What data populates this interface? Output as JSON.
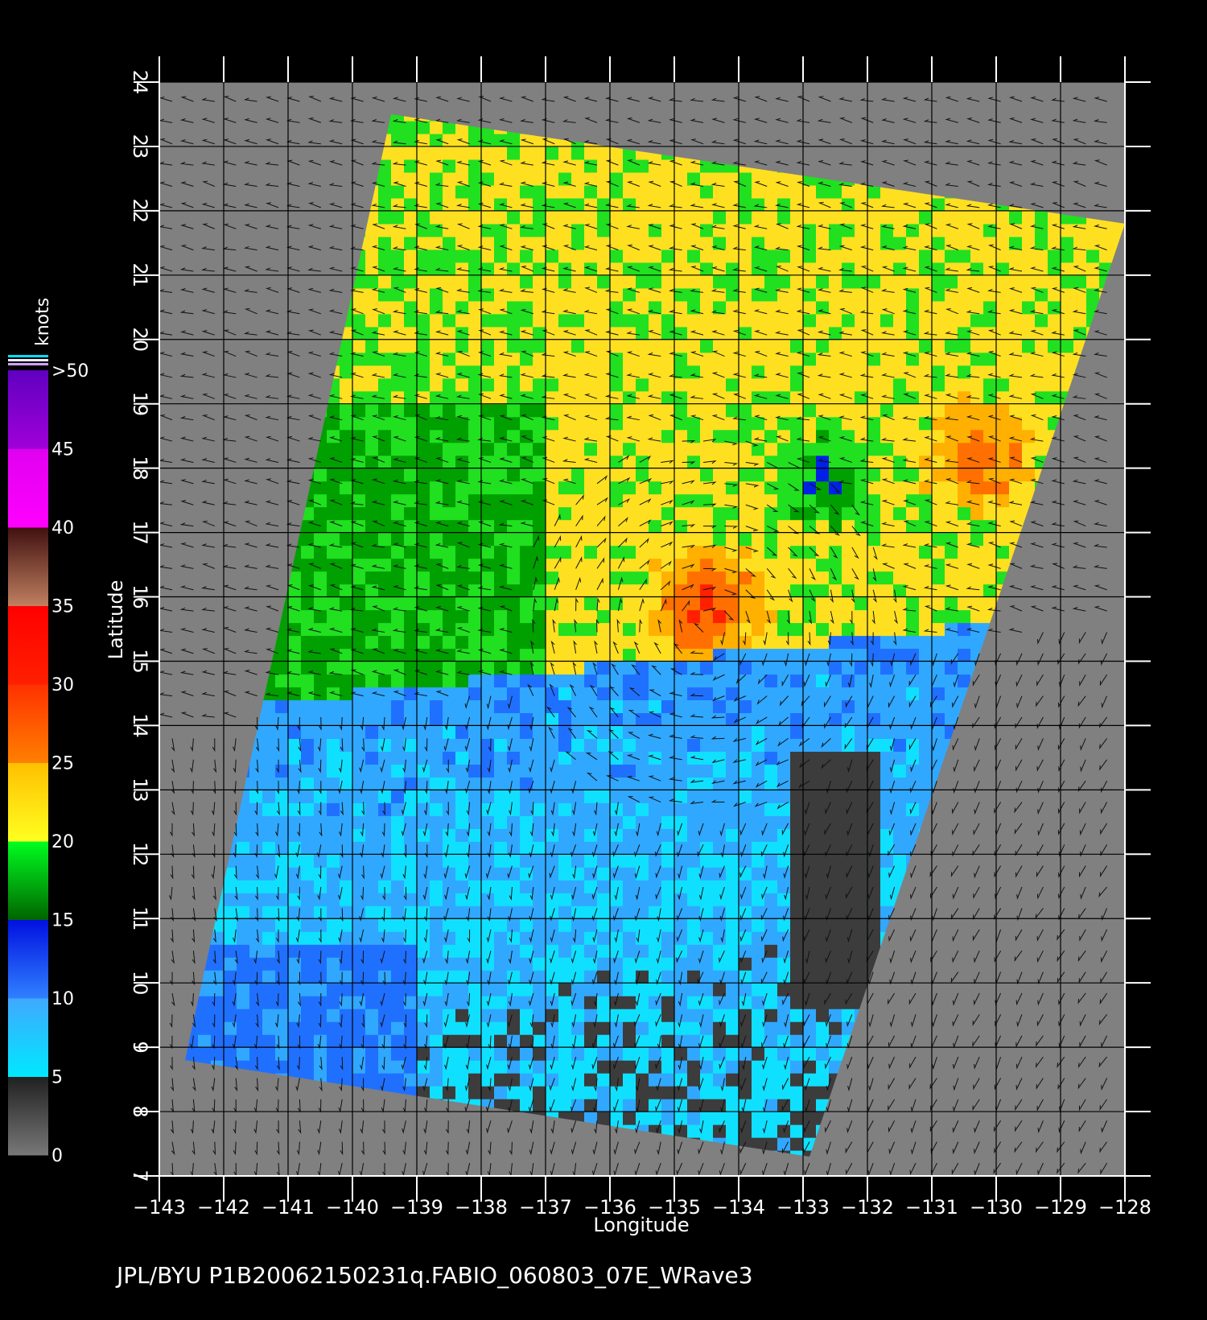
{
  "map": {
    "xlabel": "Longitude",
    "ylabel": "Latitude",
    "lon_range": [
      -143,
      -128
    ],
    "lat_range": [
      7,
      24
    ],
    "lon_ticks": [
      "−143",
      "−142",
      "−141",
      "−140",
      "−139",
      "−138",
      "−137",
      "−136",
      "−135",
      "−134",
      "−133",
      "−132",
      "−131",
      "−130",
      "−129",
      "−128"
    ],
    "lat_ticks": [
      "7",
      "8",
      "9",
      "10",
      "11",
      "12",
      "13",
      "14",
      "15",
      "16",
      "17",
      "18",
      "19",
      "20",
      "21",
      "22",
      "23",
      "24"
    ],
    "background": "#808080",
    "swath_corners_lonlat": [
      [
        -139.4,
        23.5
      ],
      [
        -128.0,
        21.8
      ],
      [
        -132.9,
        7.3
      ],
      [
        -142.6,
        8.8
      ]
    ],
    "storm_center_lonlat": [
      -134.5,
      15.5
    ]
  },
  "colorbar": {
    "units_label": "knots",
    "labels": [
      ">50",
      "45",
      "40",
      "35",
      "30",
      "25",
      "20",
      "15",
      "10",
      "5",
      "0"
    ],
    "bands": [
      {
        "from": 0,
        "to": 5,
        "colors": [
          "#787878",
          "#202020"
        ]
      },
      {
        "from": 5,
        "to": 10,
        "colors": [
          "#00e8ff",
          "#40a8ff"
        ]
      },
      {
        "from": 10,
        "to": 15,
        "colors": [
          "#3080ff",
          "#0010e0"
        ]
      },
      {
        "from": 15,
        "to": 20,
        "colors": [
          "#006400",
          "#00ff20"
        ]
      },
      {
        "from": 20,
        "to": 25,
        "colors": [
          "#ffff20",
          "#ffbf00"
        ]
      },
      {
        "from": 25,
        "to": 30,
        "colors": [
          "#ff8000",
          "#ff3000"
        ]
      },
      {
        "from": 30,
        "to": 35,
        "colors": [
          "#ff2000",
          "#ff0000"
        ]
      },
      {
        "from": 35,
        "to": 40,
        "colors": [
          "#c08060",
          "#401010"
        ]
      },
      {
        "from": 40,
        "to": 45,
        "colors": [
          "#ff00ff",
          "#e000f0"
        ]
      },
      {
        "from": 45,
        "to": 50,
        "colors": [
          "#a000d8",
          "#6000c0"
        ]
      }
    ]
  },
  "footer": {
    "text": "JPL/BYU  P1B20062150231q.FABIO_060803_07E_WRave3"
  }
}
